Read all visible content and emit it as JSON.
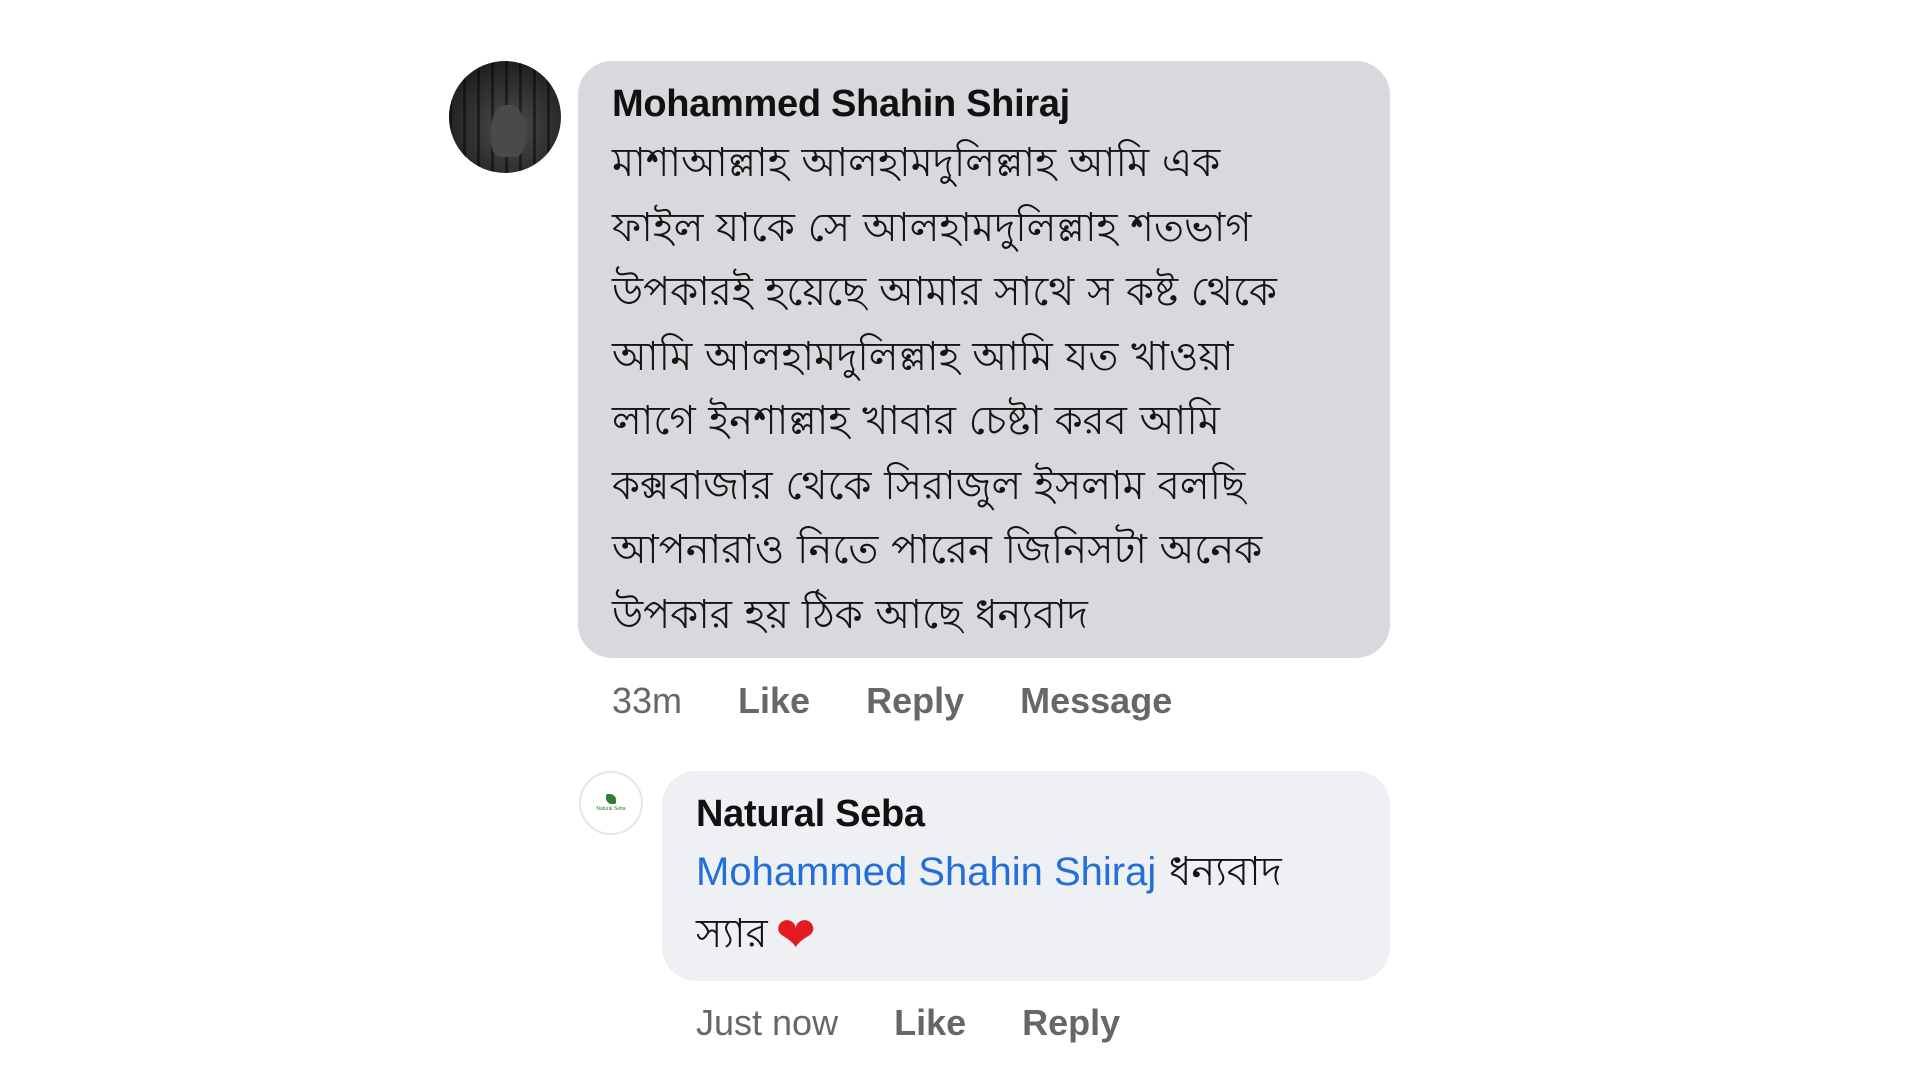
{
  "comment": {
    "author": "Mohammed Shahin Shiraj",
    "lines": [
      "মাশাআল্লাহ আলহামদুলিল্লাহ আমি এক",
      "ফাইল যাকে সে আলহামদুলিল্লাহ শতভাগ",
      "উপকারই হয়েছে আমার সাথে স কষ্ট থেকে",
      "আমি আলহামদুলিল্লাহ আমি যত খাওয়া",
      "লাগে ইনশাল্লাহ খাবার চেষ্টা করব আমি",
      "কক্সবাজার থেকে সিরাজুল ইসলাম বলছি",
      "আপনারাও নিতে পারেন জিনিসটা অনেক",
      "উপকার হয় ঠিক আছে ধন্যবাদ"
    ],
    "time": "33m",
    "like_label": "Like",
    "reply_label": "Reply",
    "message_label": "Message"
  },
  "reply": {
    "author": "Natural Seba",
    "mention": "Mohammed Shahin Shiraj",
    "text_after_mention": " ধন্যবাদ",
    "line2": "স্যার",
    "heart": "❤",
    "time": "Just now",
    "like_label": "Like",
    "reply_label": "Reply",
    "avatar_logo_text": "Natural Seba"
  },
  "colors": {
    "comment_bubble": "#d8d9dd",
    "reply_bubble": "#eff0f3",
    "mention": "#216fdb",
    "action_text": "#65676b"
  }
}
